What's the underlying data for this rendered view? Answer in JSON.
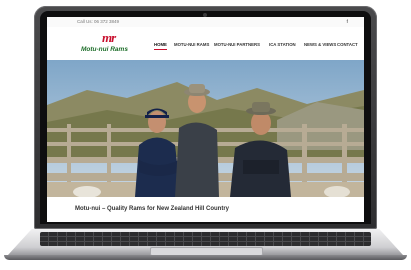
{
  "topbar": {
    "call": "Call Us: 06 372 3849",
    "facebook_glyph": "f"
  },
  "logo": {
    "mark": "mr",
    "name": "Motu-nui Rams"
  },
  "nav": {
    "items": [
      {
        "label": "HOME",
        "active": true
      },
      {
        "label": "MOTU-NUI RAMS",
        "active": false
      },
      {
        "label": "MOTU-NUI PARTNERS",
        "active": false
      },
      {
        "label": "ICA STATION",
        "active": false
      },
      {
        "label": "NEWS & VIEWS",
        "active": false
      },
      {
        "label": "CONTACT",
        "active": false
      }
    ]
  },
  "hero": {
    "caption": "Motu-nui – Quality Rams for New Zealand Hill Country"
  },
  "colors": {
    "brand_red": "#c8102e",
    "brand_green": "#1e6e2a"
  }
}
